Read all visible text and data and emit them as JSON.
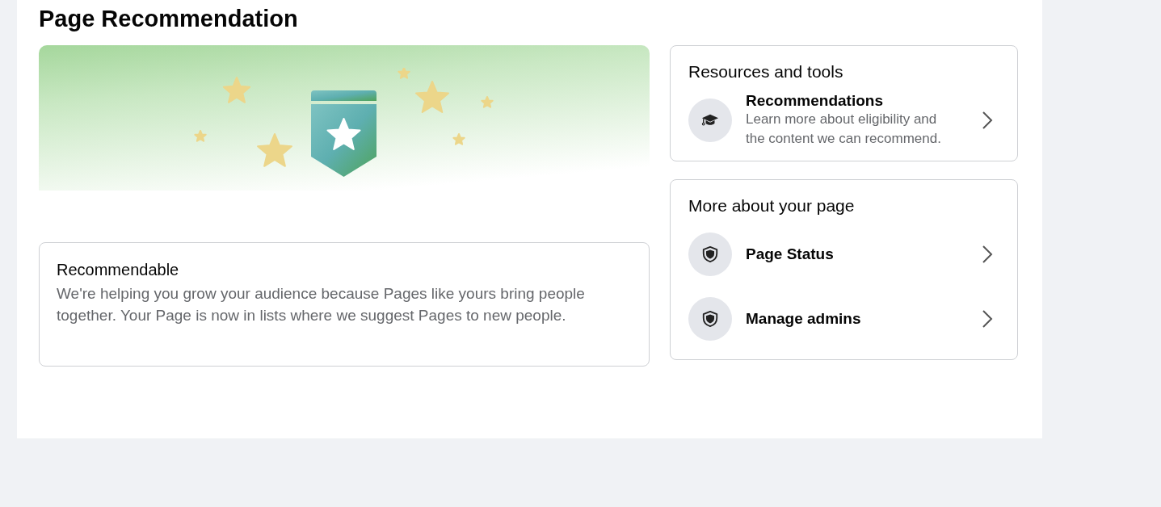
{
  "page_title": "Page Recommendation",
  "status_card": {
    "title": "Recommendable",
    "description": "We're helping you grow your audience because Pages like yours bring people together. Your Page is now in lists where we suggest Pages to new people."
  },
  "sections": [
    {
      "title": "Resources and tools",
      "items": [
        {
          "kind": "course",
          "label": "Recommendations",
          "description": "Learn more about eligibility and the content we can recommend."
        }
      ]
    },
    {
      "title": "More about your page",
      "items": [
        {
          "kind": "status",
          "label": "Page Status"
        },
        {
          "kind": "admins",
          "label": "Manage admins"
        }
      ]
    }
  ]
}
